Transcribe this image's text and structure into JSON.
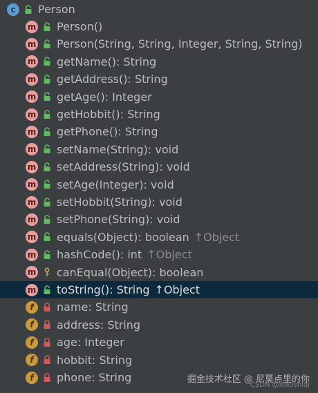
{
  "window": {
    "title": "Person"
  },
  "class": {
    "name": "Person",
    "icon": "class-c-icon",
    "visibility_icon": "public-lock-icon"
  },
  "members": [
    {
      "kind": "method",
      "visibility": "public",
      "label": "Person()",
      "inherit": ""
    },
    {
      "kind": "method",
      "visibility": "public",
      "label": "Person(String, String, Integer, String, String)",
      "inherit": ""
    },
    {
      "kind": "method",
      "visibility": "public",
      "label": "getName(): String",
      "inherit": ""
    },
    {
      "kind": "method",
      "visibility": "public",
      "label": "getAddress(): String",
      "inherit": ""
    },
    {
      "kind": "method",
      "visibility": "public",
      "label": "getAge(): Integer",
      "inherit": ""
    },
    {
      "kind": "method",
      "visibility": "public",
      "label": "getHobbit(): String",
      "inherit": ""
    },
    {
      "kind": "method",
      "visibility": "public",
      "label": "getPhone(): String",
      "inherit": ""
    },
    {
      "kind": "method",
      "visibility": "public",
      "label": "setName(String): void",
      "inherit": ""
    },
    {
      "kind": "method",
      "visibility": "public",
      "label": "setAddress(String): void",
      "inherit": ""
    },
    {
      "kind": "method",
      "visibility": "public",
      "label": "setAge(Integer): void",
      "inherit": ""
    },
    {
      "kind": "method",
      "visibility": "public",
      "label": "setHobbit(String): void",
      "inherit": ""
    },
    {
      "kind": "method",
      "visibility": "public",
      "label": "setPhone(String): void",
      "inherit": ""
    },
    {
      "kind": "method",
      "visibility": "public",
      "label": "equals(Object): boolean",
      "inherit": "↑Object"
    },
    {
      "kind": "method",
      "visibility": "public",
      "label": "hashCode(): int",
      "inherit": "↑Object"
    },
    {
      "kind": "method",
      "visibility": "protected",
      "label": "canEqual(Object): boolean",
      "inherit": ""
    },
    {
      "kind": "method",
      "visibility": "public",
      "label": "toString(): String",
      "inherit": "↑Object",
      "selected": true
    },
    {
      "kind": "field",
      "visibility": "private",
      "label": "name: String",
      "inherit": ""
    },
    {
      "kind": "field",
      "visibility": "private",
      "label": "address: String",
      "inherit": ""
    },
    {
      "kind": "field",
      "visibility": "private",
      "label": "age: Integer",
      "inherit": ""
    },
    {
      "kind": "field",
      "visibility": "private",
      "label": "hobbit: String",
      "inherit": ""
    },
    {
      "kind": "field",
      "visibility": "private",
      "label": "phone: String",
      "inherit": ""
    }
  ],
  "badges": {
    "class": "c",
    "method": "m",
    "field": "f"
  },
  "colors": {
    "background": "#3c3f41",
    "selection": "#0d293e",
    "text": "#bbbbbb",
    "public_lock": "#5fb95f",
    "private_lock": "#d05a5a",
    "protected_key": "#c8a25a"
  },
  "watermark": {
    "main": "掘金技术社区 @ 尼莫点里的你",
    "sub": "CSDN @xiaoshiqi"
  }
}
